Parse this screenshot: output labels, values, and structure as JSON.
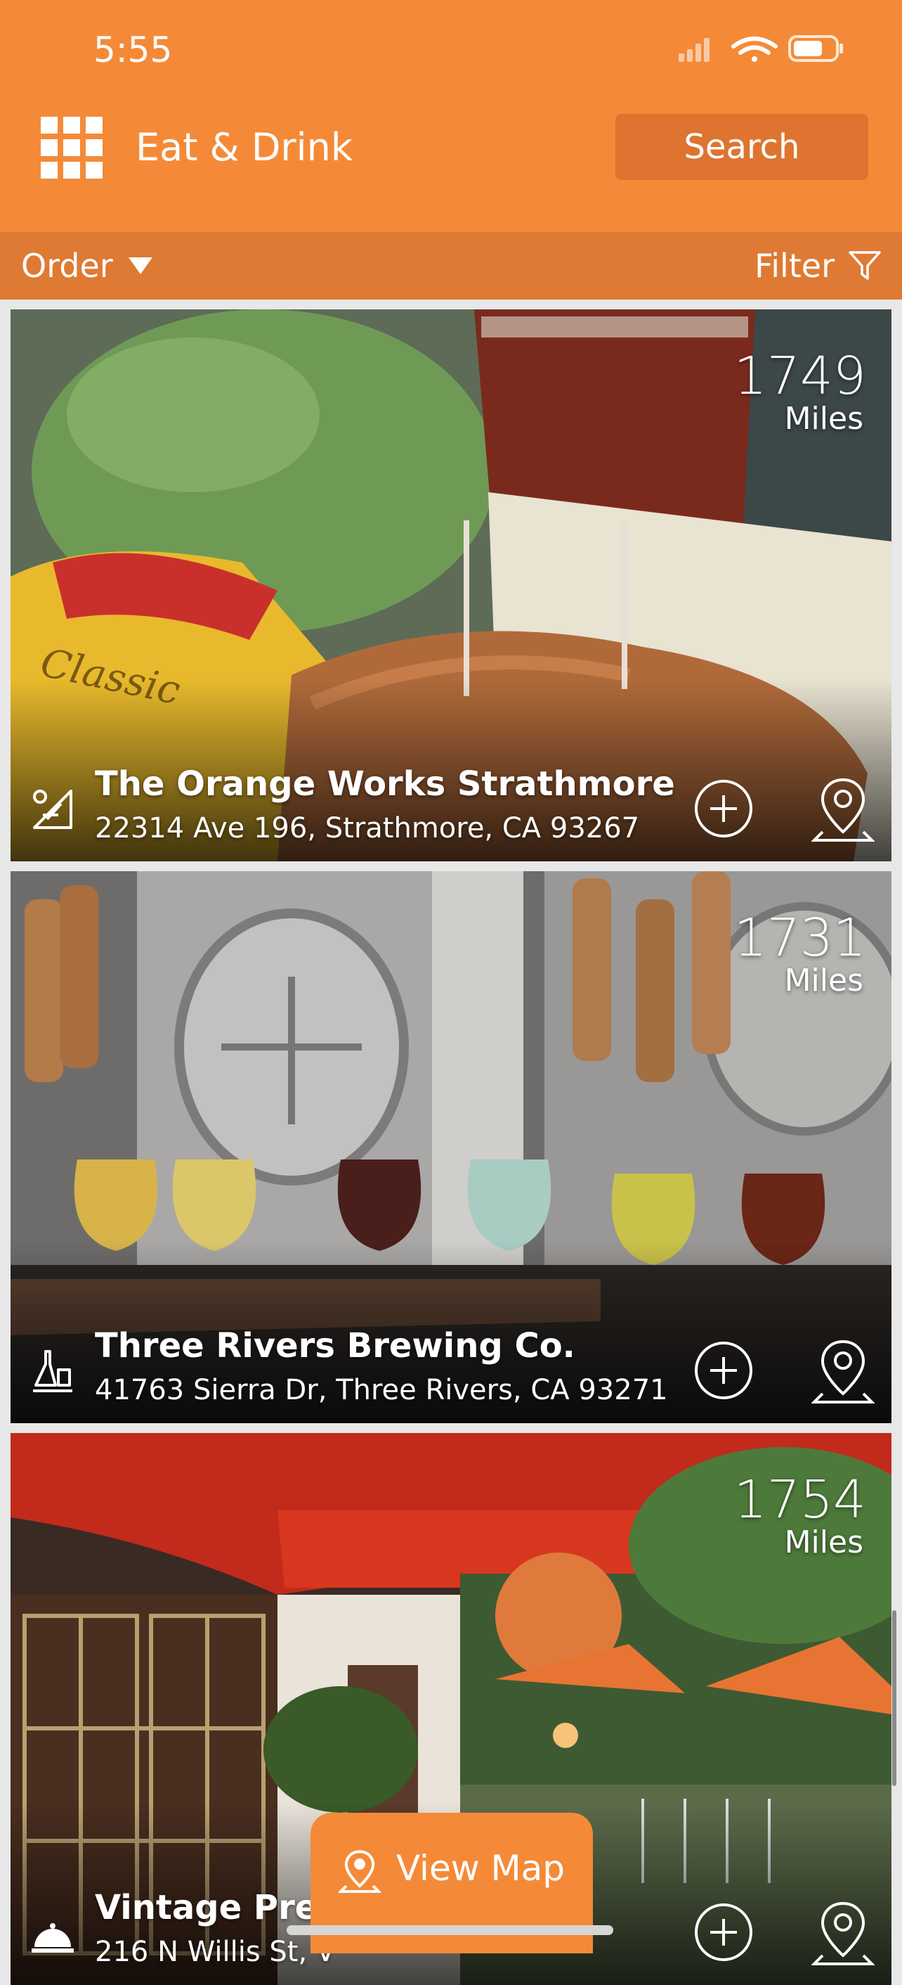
{
  "status_bar": {
    "time": "5:55"
  },
  "header": {
    "title": "Eat & Drink",
    "search_label": "Search"
  },
  "toolbar": {
    "order_label": "Order",
    "filter_label": "Filter"
  },
  "places": [
    {
      "distance": "1749",
      "unit": "Miles",
      "name": "The Orange Works Strathmore",
      "address": "22314 Ave 196, Strathmore, CA 93267",
      "category_icon": "restaurant-icon"
    },
    {
      "distance": "1731",
      "unit": "Miles",
      "name": "Three Rivers Brewing Co.",
      "address": "41763 Sierra Dr, Three Rivers, CA 93271",
      "category_icon": "brewery-icon"
    },
    {
      "distance": "1754",
      "unit": "Miles",
      "name": "Vintage Press",
      "address": "216 N Willis St, V",
      "category_icon": "dining-icon"
    }
  ],
  "map_button": {
    "label": "View Map"
  },
  "colors": {
    "brand_orange": "#f48a37",
    "toolbar_orange": "#de7a33"
  }
}
